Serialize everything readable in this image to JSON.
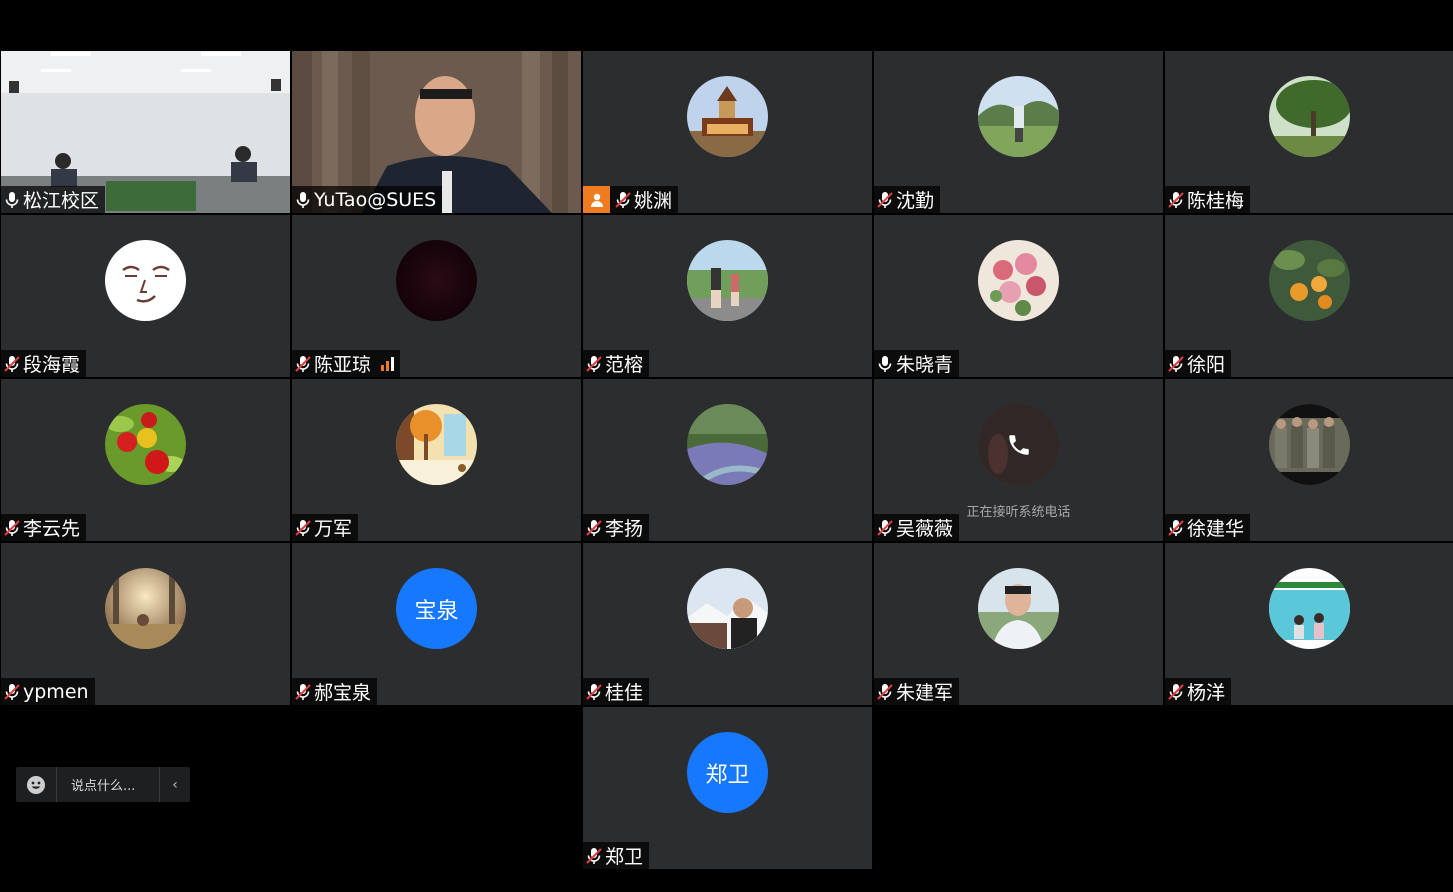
{
  "participants": [
    {
      "name": "松江校区",
      "mic": "on"
    },
    {
      "name": "YuTao@SUES",
      "mic": "on"
    },
    {
      "name": "姚渊",
      "mic": "muted",
      "host_badge_icon": "person-icon"
    },
    {
      "name": "沈勤",
      "mic": "muted"
    },
    {
      "name": "陈桂梅",
      "mic": "muted"
    },
    {
      "name": "段海霞",
      "mic": "muted"
    },
    {
      "name": "陈亚琼",
      "mic": "muted",
      "signal_icon": "signal-bars-icon"
    },
    {
      "name": "范榕",
      "mic": "muted"
    },
    {
      "name": "朱晓青",
      "mic": "on"
    },
    {
      "name": "徐阳",
      "mic": "muted"
    },
    {
      "name": "李云先",
      "mic": "muted"
    },
    {
      "name": "万军",
      "mic": "muted"
    },
    {
      "name": "李扬",
      "mic": "muted"
    },
    {
      "name": "吴薇薇",
      "mic": "muted",
      "status": "正在接听系统电话"
    },
    {
      "name": "徐建华",
      "mic": "muted"
    },
    {
      "name": "ypmen",
      "mic": "muted"
    },
    {
      "name": "郝宝泉",
      "mic": "muted",
      "avatar_text": "宝泉"
    },
    {
      "name": "桂佳",
      "mic": "muted"
    },
    {
      "name": "朱建军",
      "mic": "muted"
    },
    {
      "name": "杨洋",
      "mic": "muted"
    },
    {
      "name": "郑卫",
      "mic": "muted",
      "avatar_text": "郑卫"
    }
  ],
  "chat": {
    "placeholder": "说点什么...",
    "emoji_icon": "emoji-icon",
    "collapse_icon": "chevron-left-icon"
  },
  "colors": {
    "tile_bg": "#2c2d2f",
    "avatar_blue": "#1677ff",
    "badge_orange": "#f07c22",
    "active_border": "#2bd36b"
  }
}
